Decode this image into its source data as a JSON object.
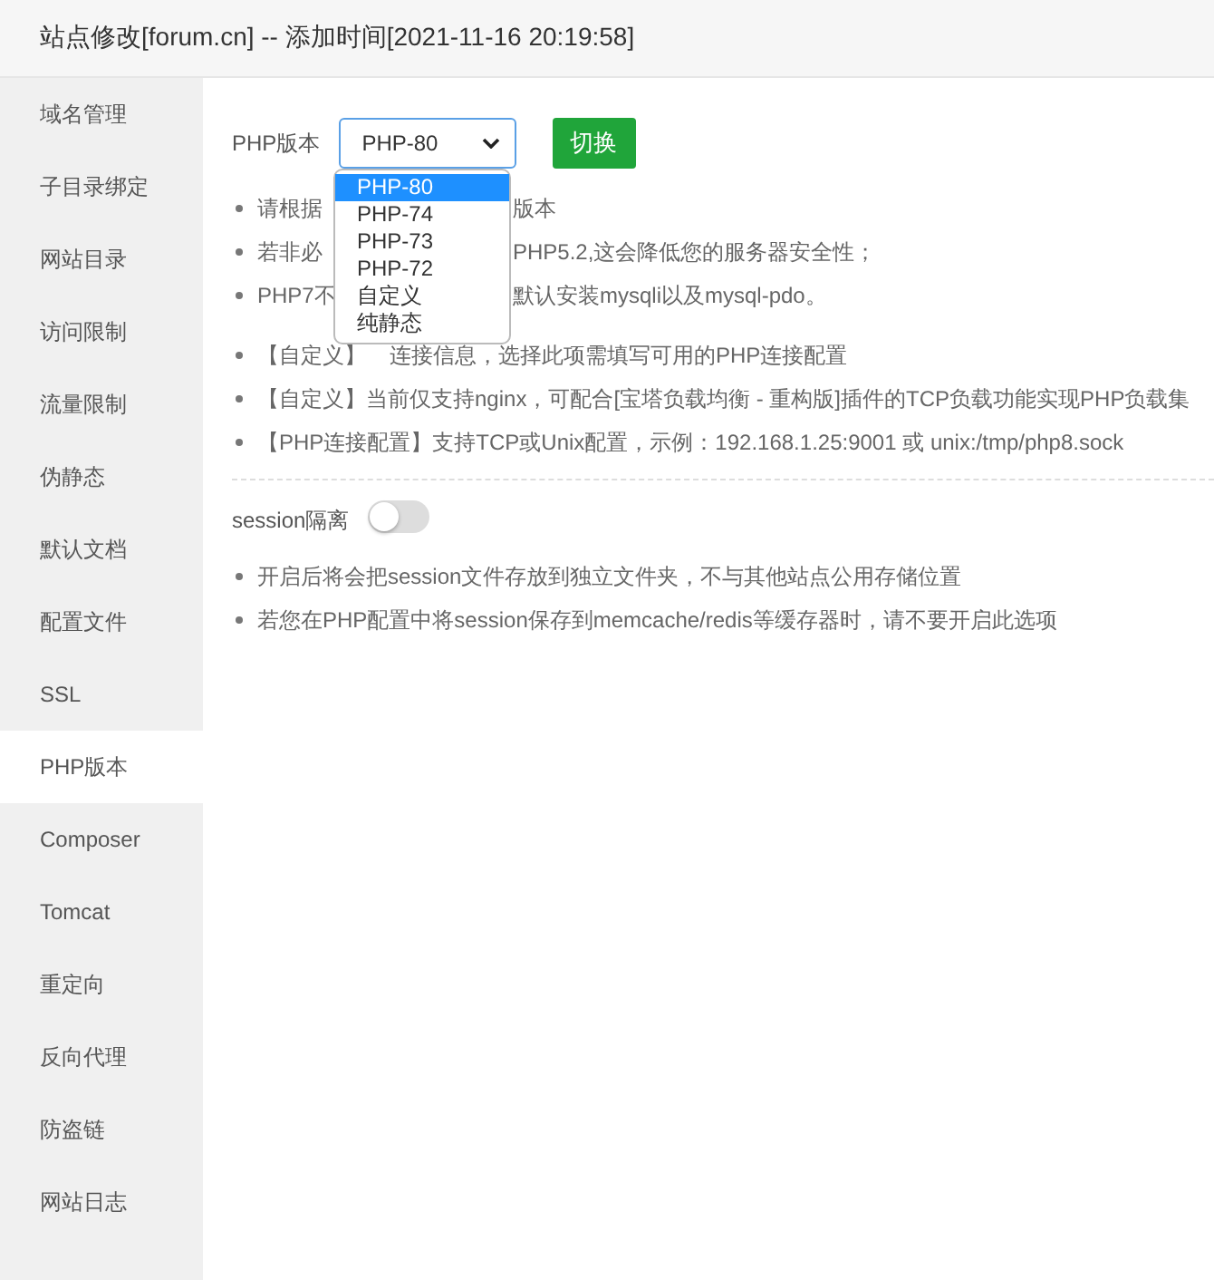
{
  "window": {
    "title": "站点修改[forum.cn] -- 添加时间[2021-11-16 20:19:58]"
  },
  "sidebar": {
    "items": [
      {
        "label": "域名管理",
        "selected": false
      },
      {
        "label": "子目录绑定",
        "selected": false
      },
      {
        "label": "网站目录",
        "selected": false
      },
      {
        "label": "访问限制",
        "selected": false
      },
      {
        "label": "流量限制",
        "selected": false
      },
      {
        "label": "伪静态",
        "selected": false
      },
      {
        "label": "默认文档",
        "selected": false
      },
      {
        "label": "配置文件",
        "selected": false
      },
      {
        "label": "SSL",
        "selected": false
      },
      {
        "label": "PHP版本",
        "selected": true
      },
      {
        "label": "Composer",
        "selected": false
      },
      {
        "label": "Tomcat",
        "selected": false
      },
      {
        "label": "重定向",
        "selected": false
      },
      {
        "label": "反向代理",
        "selected": false
      },
      {
        "label": "防盗链",
        "selected": false
      },
      {
        "label": "网站日志",
        "selected": false
      }
    ]
  },
  "php_version": {
    "label": "PHP版本",
    "value": "PHP-80",
    "options": [
      {
        "label": "PHP-80",
        "selected": true
      },
      {
        "label": "PHP-74",
        "selected": false
      },
      {
        "label": "PHP-73",
        "selected": false
      },
      {
        "label": "PHP-72",
        "selected": false
      },
      {
        "label": "自定义",
        "selected": false
      },
      {
        "label": "纯静态",
        "selected": false
      }
    ],
    "button": "切换"
  },
  "notes": [
    {
      "left": "请根据",
      "right": "版本"
    },
    {
      "left": "若非必",
      "right": "PHP5.2,这会降低您的服务器安全性；"
    },
    {
      "left": "PHP7不",
      "right": "默认安装mysqli以及mysql-pdo。"
    },
    {
      "left": "【自定义】",
      "right": "连接信息，选择此项需填写可用的PHP连接配置"
    },
    {
      "left": "【自定义】当前仅支持nginx，可配合[宝塔负载均衡 - 重构版]插件的TCP负载功能实现PHP负载集"
    },
    {
      "left": "【PHP连接配置】支持TCP或Unix配置，示例：192.168.1.25:9001 或 unix:/tmp/php8.sock"
    }
  ],
  "session": {
    "label": "session隔离",
    "on": false
  },
  "session_notes": [
    "开启后将会把session文件存放到独立文件夹，不与其他站点公用存储位置",
    "若您在PHP配置中将session保存到memcache/redis等缓存器时，请不要开启此选项"
  ]
}
